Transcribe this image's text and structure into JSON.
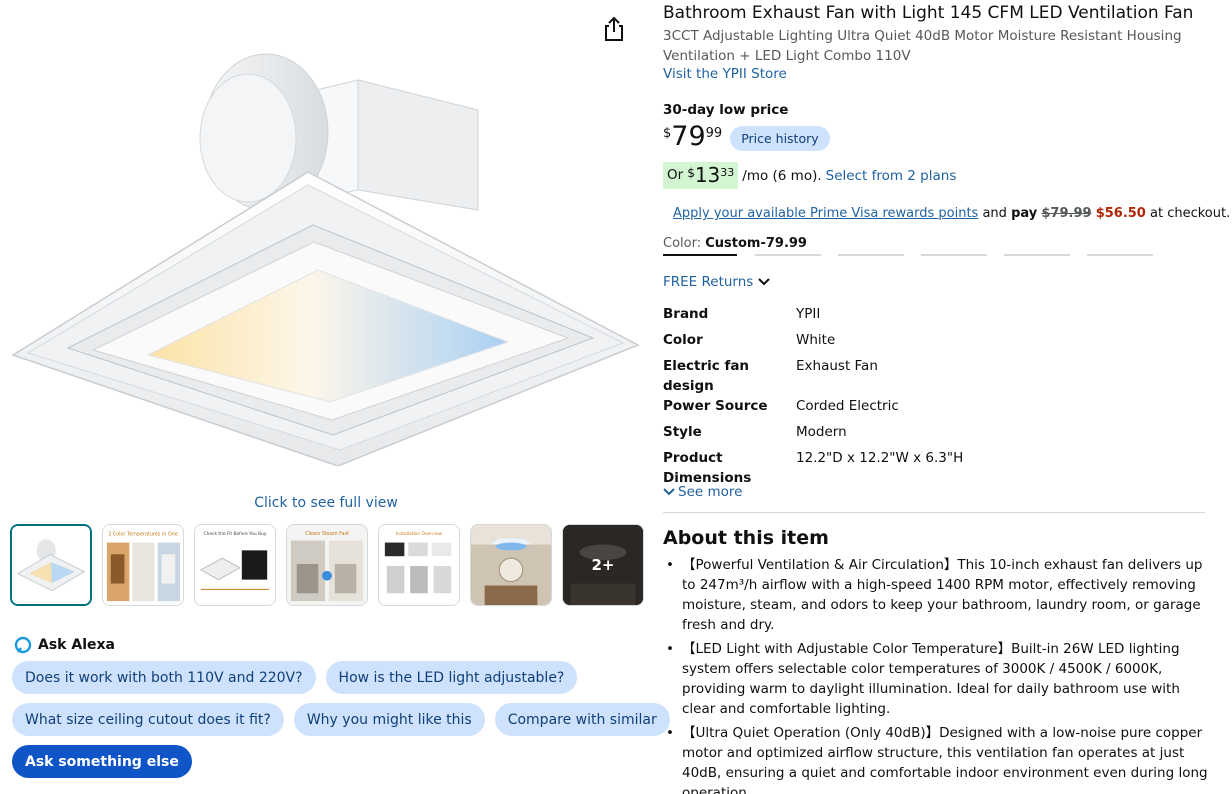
{
  "product": {
    "title": "Bathroom Exhaust Fan with Light 145 CFM LED Ventilation Fan",
    "subtitle": "3CCT Adjustable Lighting Ultra Quiet 40dB Motor Moisture Resistant Housing Ventilation + LED Light Combo 110V",
    "store_link": "Visit the YPII Store"
  },
  "gallery": {
    "full_view_label": "Click to see full view",
    "more_thumbs_label": "2+",
    "thumb_captions": [
      "3 Color Temperatures In One",
      "Check the Fit Before You Buy",
      "Clears Steam Fast",
      "Installation Overview"
    ]
  },
  "pricing": {
    "low_price_label": "30-day low price",
    "currency": "$",
    "price_whole": "79",
    "price_fraction": "99",
    "price_history_label": "Price history",
    "monthly_prefix": "Or",
    "monthly_whole": "13",
    "monthly_fraction": "33",
    "monthly_suffix": "/mo (6 mo).",
    "plans_link": "Select from 2 plans",
    "prime_link": "Apply your available Prime Visa rewards points",
    "prime_and": "and",
    "prime_pay": "pay",
    "prime_old_price": "$79.99",
    "prime_new_price": "$56.50",
    "prime_suffix": "at checkout."
  },
  "variant": {
    "color_label": "Color:",
    "color_value": "Custom-79.99"
  },
  "returns": {
    "label": "FREE Returns"
  },
  "specs": [
    {
      "key": "Brand",
      "value": "YPII"
    },
    {
      "key": "Color",
      "value": "White"
    },
    {
      "key": "Electric fan design",
      "value": "Exhaust Fan"
    },
    {
      "key": "Power Source",
      "value": "Corded Electric"
    },
    {
      "key": "Style",
      "value": "Modern"
    },
    {
      "key": "Product Dimensions",
      "value": "12.2\"D x 12.2\"W x 6.3\"H"
    }
  ],
  "see_more_label": "See more",
  "about": {
    "title": "About this item",
    "bullets": [
      "【Powerful Ventilation & Air Circulation】This 10-inch exhaust fan delivers up to 247m³/h airflow with a high-speed 1400 RPM motor, effectively removing moisture, steam, and odors to keep your bathroom, laundry room, or garage fresh and dry.",
      "【LED Light with Adjustable Color Temperature】Built-in 26W LED lighting system offers selectable color temperatures of 3000K / 4500K / 6000K, providing warm to daylight illumination. Ideal for daily bathroom use with clear and comfortable lighting.",
      "【Ultra Quiet Operation (Only 40dB)】Designed with a low-noise pure copper motor and optimized airflow structure, this ventilation fan operates at just 40dB, ensuring a quiet and comfortable indoor environment even during long operation."
    ]
  },
  "alexa": {
    "title": "Ask Alexa",
    "chips": [
      "Does it work with both 110V and 220V?",
      "How is the LED light adjustable?",
      "What size ceiling cutout does it fit?",
      "Why you might like this",
      "Compare with similar"
    ],
    "primary_chip": "Ask something else"
  },
  "colors": {
    "link": "#2162a1",
    "price_red": "#b12704",
    "chip_bg": "#cfe2fd",
    "primary_chip_bg": "#0f55c8",
    "monthly_bg": "#d3f5d1"
  }
}
